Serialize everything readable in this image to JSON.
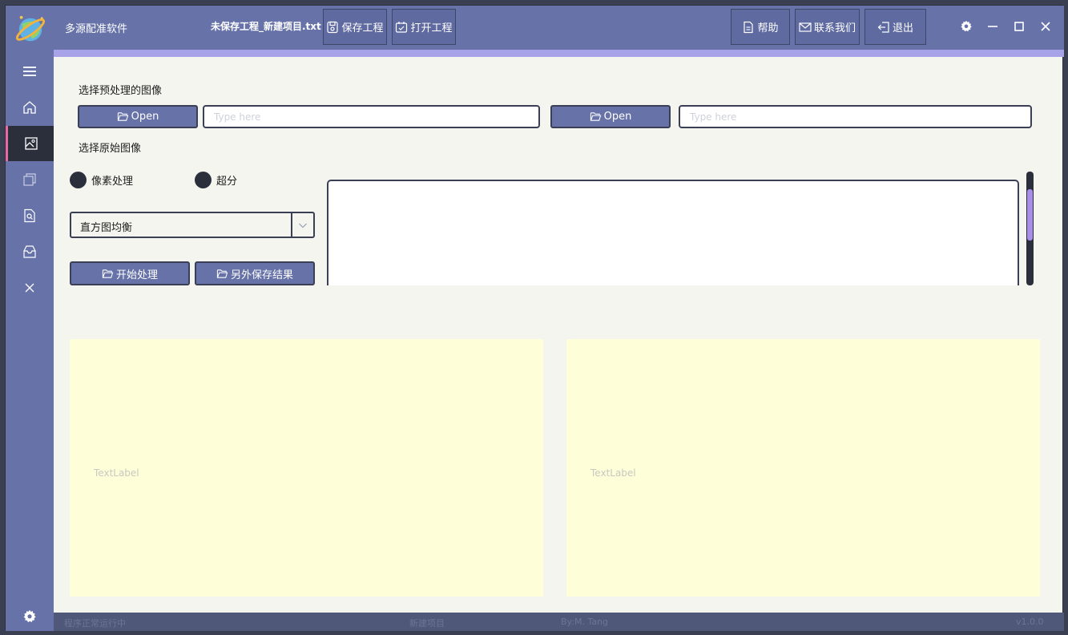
{
  "app": {
    "title": "多源配准软件",
    "project_file": "未保存工程_新建项目.txt"
  },
  "toolbar": {
    "save_project": "保存工程",
    "open_project": "打开工程",
    "help": "帮助",
    "contact": "联系我们",
    "exit": "退出"
  },
  "sidebar": {
    "items": [
      {
        "icon": "menu-icon"
      },
      {
        "icon": "home-icon"
      },
      {
        "icon": "image-icon",
        "active": true
      },
      {
        "icon": "copy-icon"
      },
      {
        "icon": "search-doc-icon"
      },
      {
        "icon": "inbox-icon"
      },
      {
        "icon": "close-icon"
      }
    ],
    "bottom_icon": "gear-icon"
  },
  "main": {
    "preprocessed_label": "选择预处理的图像",
    "original_label": "选择原始图像",
    "open_button_1": "Open",
    "open_button_2": "Open",
    "input_1": {
      "value": "",
      "placeholder": "Type here"
    },
    "input_2": {
      "value": "",
      "placeholder": "Type here"
    },
    "radio_pixel": "像素处理",
    "radio_superres": "超分",
    "method_select": "直方图均衡",
    "start_button": "开始处理",
    "save_as_button": "另外保存结果",
    "text_output": "",
    "left_panel_label": "TextLabel",
    "right_panel_label": "TextLabel"
  },
  "status": {
    "state": "程序正常运行中",
    "project": "新建项目",
    "author": "By:M. Tang",
    "version": "v1.0.0"
  },
  "colors": {
    "titlebar": "#6672a8",
    "accent": "#a8a3e8",
    "sidebar_active": "#2b2f3c",
    "active_marker": "#e86aa4",
    "panel_bg": "#fefed9"
  }
}
